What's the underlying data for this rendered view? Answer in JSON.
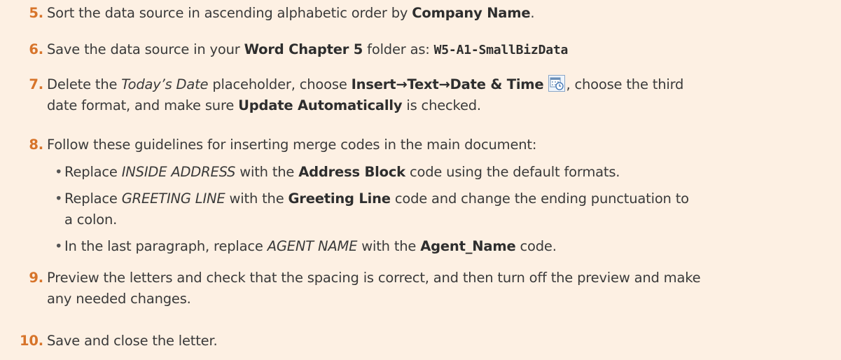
{
  "steps": [
    {
      "num": "5.",
      "a": "Sort the data source in ascending alphabetic order by ",
      "b": "Company Name",
      "c": "."
    },
    {
      "num": "6.",
      "a": "Save the data source in your ",
      "b": "Word Chapter 5",
      "c": " folder as: ",
      "code": "W5-A1-SmallBizData"
    },
    {
      "num": "7.",
      "a": "Delete the ",
      "i": "Today’s Date",
      "c": " placeholder, choose ",
      "b1": "Insert→Text→Date & Time",
      "d": ", choose the third",
      "line2a": "date format, and make sure ",
      "b2": "Update Automatically",
      "line2b": " is checked."
    },
    {
      "num": "8.",
      "a": "Follow these guidelines for inserting merge codes in the main document:"
    },
    {
      "num": "9.",
      "line1": "Preview the letters and check that the spacing is correct, and then turn off the preview and make",
      "line2": "any needed changes."
    },
    {
      "num": "10.",
      "a": "Save and close the letter."
    }
  ],
  "bullets": [
    {
      "a": "Replace ",
      "i": "INSIDE ADDRESS",
      "b": " with the ",
      "bold": "Address Block",
      "c": " code using the default formats."
    },
    {
      "a": "Replace ",
      "i": "GREETING LINE",
      "b": " with the ",
      "bold": "Greeting Line",
      "c": " code and change the ending punctuation to",
      "line2": "a colon."
    },
    {
      "a": "In the last paragraph, replace ",
      "i": "AGENT NAME",
      "b": " with the ",
      "bold": "Agent_Name",
      "c": " code."
    }
  ],
  "bullet_char": "•",
  "icon": "date-time-icon",
  "colors": {
    "background": "#fdf0e3",
    "step_number": "#d7742a"
  }
}
